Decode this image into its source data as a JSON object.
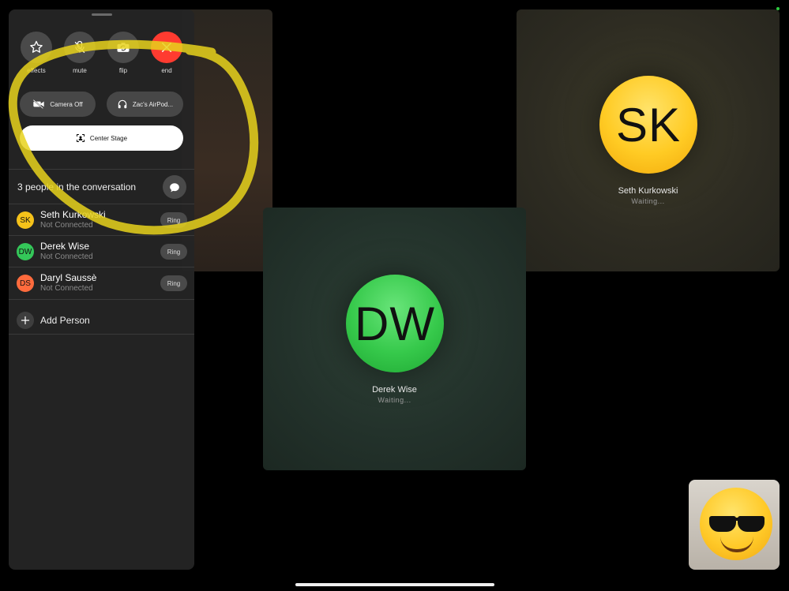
{
  "controls": {
    "effects_label": "effects",
    "mute_label": "mute",
    "flip_label": "flip",
    "end_label": "end"
  },
  "buttons": {
    "camera_off": "Camera Off",
    "audio_route": "Zac's AirPod...",
    "center_stage": "Center Stage"
  },
  "conversation": {
    "title": "3 people in the conversation",
    "participants": [
      {
        "initials": "SK",
        "name": "Seth Kurkowski",
        "status": "Not Connected",
        "ring_label": "Ring",
        "color": "#f5c21a"
      },
      {
        "initials": "DW",
        "name": "Derek Wise",
        "status": "Not Connected",
        "ring_label": "Ring",
        "color": "#34c759"
      },
      {
        "initials": "DS",
        "name": "Daryl Saussè",
        "status": "Not Connected",
        "ring_label": "Ring",
        "color": "#ff6b3d"
      }
    ],
    "add_person_label": "Add Person"
  },
  "tiles": {
    "seth": {
      "initials": "SK",
      "name": "Seth Kurkowski",
      "status": "Waiting..."
    },
    "derek": {
      "initials": "DW",
      "name": "Derek Wise",
      "status": "Waiting..."
    }
  },
  "icons": {
    "effects": "star-icon",
    "mute": "mic-slash-icon",
    "flip": "camera-flip-icon",
    "end": "close-icon",
    "camera_off": "video-slash-icon",
    "audio": "headphones-icon",
    "center_stage": "center-stage-icon",
    "message": "message-bubble-icon",
    "add": "plus-icon"
  },
  "colors": {
    "end_red": "#ff3b30",
    "highlight_yellow": "#e8d21c",
    "sk_yellow": "#ffcb24",
    "dw_green": "#36c94b"
  }
}
